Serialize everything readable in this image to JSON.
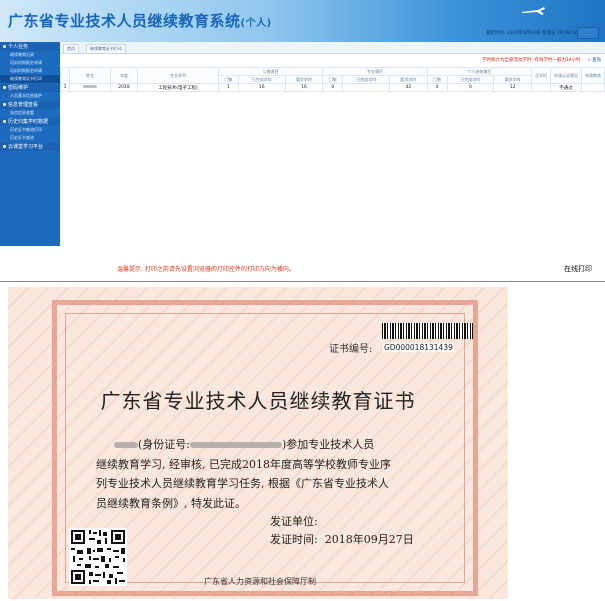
{
  "header": {
    "title": "广东省专业技术人员继续教育系统",
    "title_suffix": "(个人)",
    "info": "最近时间: 2019年6月14日 星期五 19:09:52"
  },
  "sidebar": {
    "items": [
      {
        "label": "个人业务",
        "type": "group"
      },
      {
        "label": "继续教育记录",
        "type": "sub"
      },
      {
        "label": "培训机构报名申请",
        "type": "sub"
      },
      {
        "label": "培训机构报名申请",
        "type": "sub"
      },
      {
        "label": "继续教育证书打印",
        "type": "sub",
        "active": true
      },
      {
        "label": "密码维护",
        "type": "group"
      },
      {
        "label": "人员基本信息维护",
        "type": "sub"
      },
      {
        "label": "信息管理查看",
        "type": "group"
      },
      {
        "label": "失信信息查看",
        "type": "sub"
      },
      {
        "label": "历史归集学时数据",
        "type": "group"
      },
      {
        "label": "历史证书查询打印",
        "type": "sub"
      },
      {
        "label": "历史证书查询",
        "type": "sub"
      },
      {
        "label": "云课堂学习平台",
        "type": "group"
      }
    ]
  },
  "tabs": [
    "首页",
    "继续教育证书打印"
  ],
  "notice": "学时统计为全部活动学时, 有效学时一般为24小时",
  "query_label": "查询",
  "table": {
    "headers_top": [
      "",
      "姓名",
      "年度",
      "专业系列",
      "公需课目",
      "专业课目",
      "个人选修课目",
      "总学时",
      "申请认证情况",
      "申请教育"
    ],
    "headers_sub": [
      "门数",
      "已完成学时",
      "要求学时",
      "门数",
      "已完成学时",
      "要求学时",
      "门数",
      "已完成学时",
      "要求学时"
    ],
    "rows": [
      {
        "index": "1",
        "name": "",
        "year": "2018",
        "series": "工程技术(电子工程)",
        "c1": "1",
        "c2": "16",
        "c3": "16",
        "c4": "0",
        "c5": "",
        "c6": "42",
        "c7": "0",
        "c8": "0",
        "c9": "12",
        "total": "",
        "status": "不通过",
        "apply": ""
      }
    ]
  },
  "tip": "温馨提示: 打印之前请先设置浏览器的打印控件的打印方向为横向。",
  "print_button": "在线打印",
  "certificate": {
    "number_label": "证书编号:",
    "number": "GD000018131439",
    "title": "广东省专业技术人员继续教育证书",
    "id_prefix": "(身份证号:",
    "id_suffix": ")参加专业技术人员",
    "line2": "继续教育学习, 经审核, 已完成2018年度高等学校教师专业序",
    "line3": "列专业技术人员继续教育学习任务, 根据《广东省专业技术人",
    "line4": "员继续教育条例》, 特发此证。",
    "issuer_label": "发证单位:",
    "date_label": "发证时间:",
    "date": "2018年09月27日",
    "bureau": "广东省人力资源和社会保障厅制"
  },
  "colors": {
    "header_blue": "#1966b7",
    "sidebar_blue": "#1d6bbf",
    "notice_red": "#d8231f",
    "cert_pink": "#fae7de",
    "cert_border": "#e7a794"
  }
}
